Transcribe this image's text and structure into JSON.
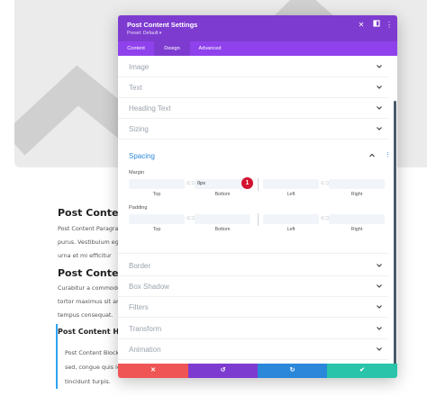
{
  "background": {
    "h1": "Post Content",
    "p1a": "Post Content Paragrap",
    "p1b": "purus. Vestibulum eges",
    "h2": "Post Content H",
    "p2a": "Curabitur a commodo s",
    "p2b": "tortor maximus sit ame",
    "p2c": "tempus consequat.",
    "h3": "Post Content Hea",
    "q1": "Post Content Block",
    "q2": "sed, congue quis lec",
    "q3": "tincidunt turpis."
  },
  "modal": {
    "title": "Post Content Settings",
    "preset": "Preset: Default ▾",
    "tabs": [
      "Content",
      "Design",
      "Advanced"
    ],
    "sections": [
      "Image",
      "Text",
      "Heading Text",
      "Sizing",
      "Spacing",
      "Border",
      "Box Shadow",
      "Filters",
      "Transform",
      "Animation"
    ],
    "spacing": {
      "margin_label": "Margin",
      "padding_label": "Padding",
      "margin_bottom_value": "0px",
      "subs": [
        "Top",
        "Bottom",
        "Left",
        "Right"
      ],
      "badge": "1"
    }
  },
  "colors": {
    "header": "#7e3bd0",
    "tabs": "#8f42ec",
    "cancel": "#ef5555",
    "undo": "#7e3bd0",
    "redo": "#2b87da",
    "save": "#29c4a9"
  }
}
